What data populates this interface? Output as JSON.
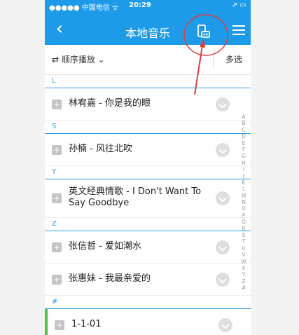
{
  "status_bar": {
    "signal_carrier": "●●●●● 中国电信 ᯤ",
    "time": "20:29",
    "right": "⇗ ▭"
  },
  "nav": {
    "back": "‹",
    "title": "本地音乐",
    "device_icon": "speaker-device-icon",
    "menu_icon": "menu-icon"
  },
  "toolbar": {
    "sort_label": "⇄ 顺序播放 ⌄",
    "multi_select": "多选"
  },
  "sections": [
    {
      "letter": "L",
      "songs": [
        {
          "title": "林宥嘉 - 你是我的眼"
        }
      ]
    },
    {
      "letter": "S",
      "songs": [
        {
          "title": "孙楠 - 风往北吹"
        }
      ]
    },
    {
      "letter": "Y",
      "songs": [
        {
          "title": "英文经典情歌 - I Don't Want To Say Goodbye",
          "line1": "英文经典情歌 - I Don't Want To",
          "line2": "Say Goodbye"
        }
      ]
    },
    {
      "letter": "Z",
      "songs": [
        {
          "title": "张信哲 - 爱如潮水"
        },
        {
          "title": "张惠妹 - 我最亲爱的"
        }
      ]
    },
    {
      "letter": "#",
      "songs": [
        {
          "title": "1-1-01"
        }
      ]
    }
  ],
  "row_plus": "+",
  "index_letters": [
    "A",
    "B",
    "C",
    "D",
    "E",
    "F",
    "G",
    "H",
    "I",
    "J",
    "K",
    "L",
    "M",
    "N",
    "O",
    "P",
    "Q",
    "R",
    "S",
    "T",
    "U",
    "V",
    "W",
    "X",
    "Y",
    "Z",
    "#"
  ],
  "colors": {
    "header_bg": "#1e9be8",
    "accent_blue": "#2e9be4",
    "annotation_red": "#e03b3b",
    "playing_green": "#4bc840"
  }
}
